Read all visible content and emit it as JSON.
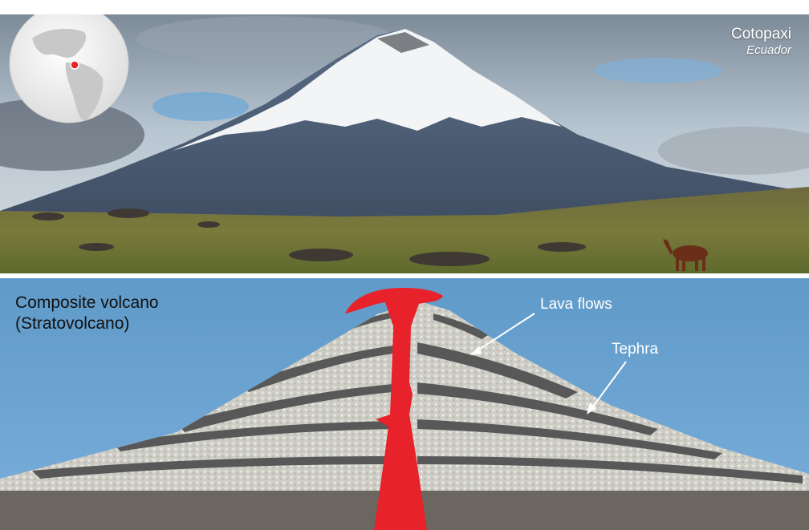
{
  "photo": {
    "volcano_name": "Cotopaxi",
    "country": "Ecuador"
  },
  "diagram": {
    "title_line1": "Composite volcano",
    "title_line2": "(Stratovolcano)",
    "labels": {
      "lava_flows": "Lava flows",
      "tephra": "Tephra"
    }
  },
  "colors": {
    "sky_blue": "#5f9ac8",
    "magma_red": "#e8222a",
    "lava_layer": "#585858",
    "tephra_layer": "#cdcdc6",
    "ground": "#6b6660"
  }
}
